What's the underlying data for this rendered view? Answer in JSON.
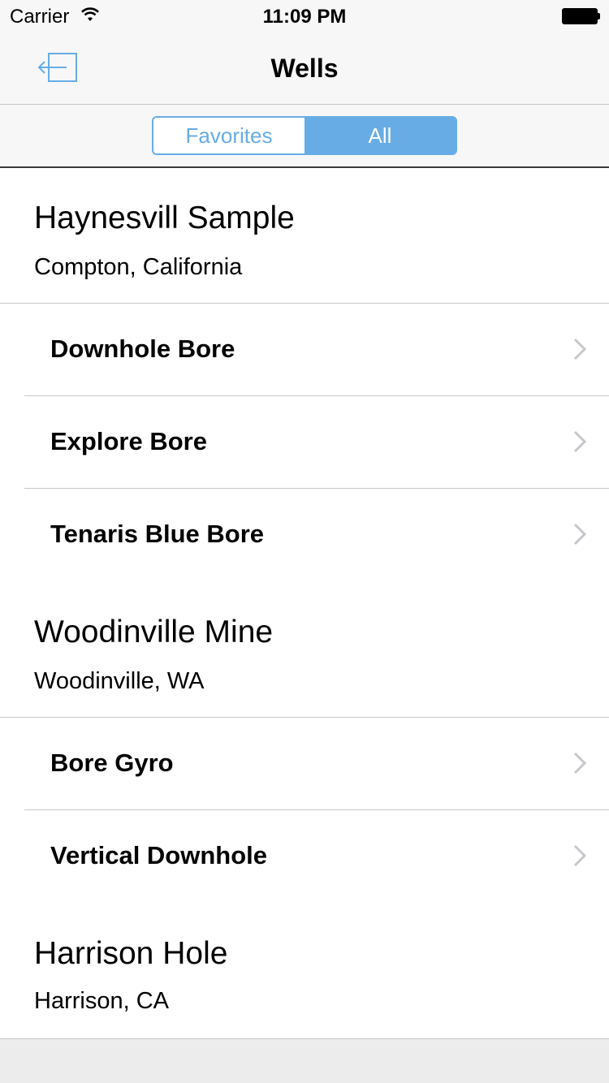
{
  "status_bar": {
    "carrier": "Carrier",
    "time": "11:09 PM"
  },
  "nav": {
    "title": "Wells",
    "back_icon": "exit-arrow-icon"
  },
  "segments": [
    {
      "label": "Favorites",
      "selected": false
    },
    {
      "label": "All",
      "selected": true
    }
  ],
  "accent_color": "#67ace4",
  "sections": [
    {
      "name": "Haynesvill Sample",
      "location": "Compton, California",
      "items": [
        "Downhole Bore",
        "Explore Bore",
        "Tenaris Blue Bore"
      ]
    },
    {
      "name": "Woodinville Mine",
      "location": "Woodinville, WA",
      "items": [
        "Bore Gyro",
        "Vertical Downhole"
      ]
    },
    {
      "name": "Harrison Hole",
      "location": "Harrison, CA",
      "items": []
    }
  ]
}
